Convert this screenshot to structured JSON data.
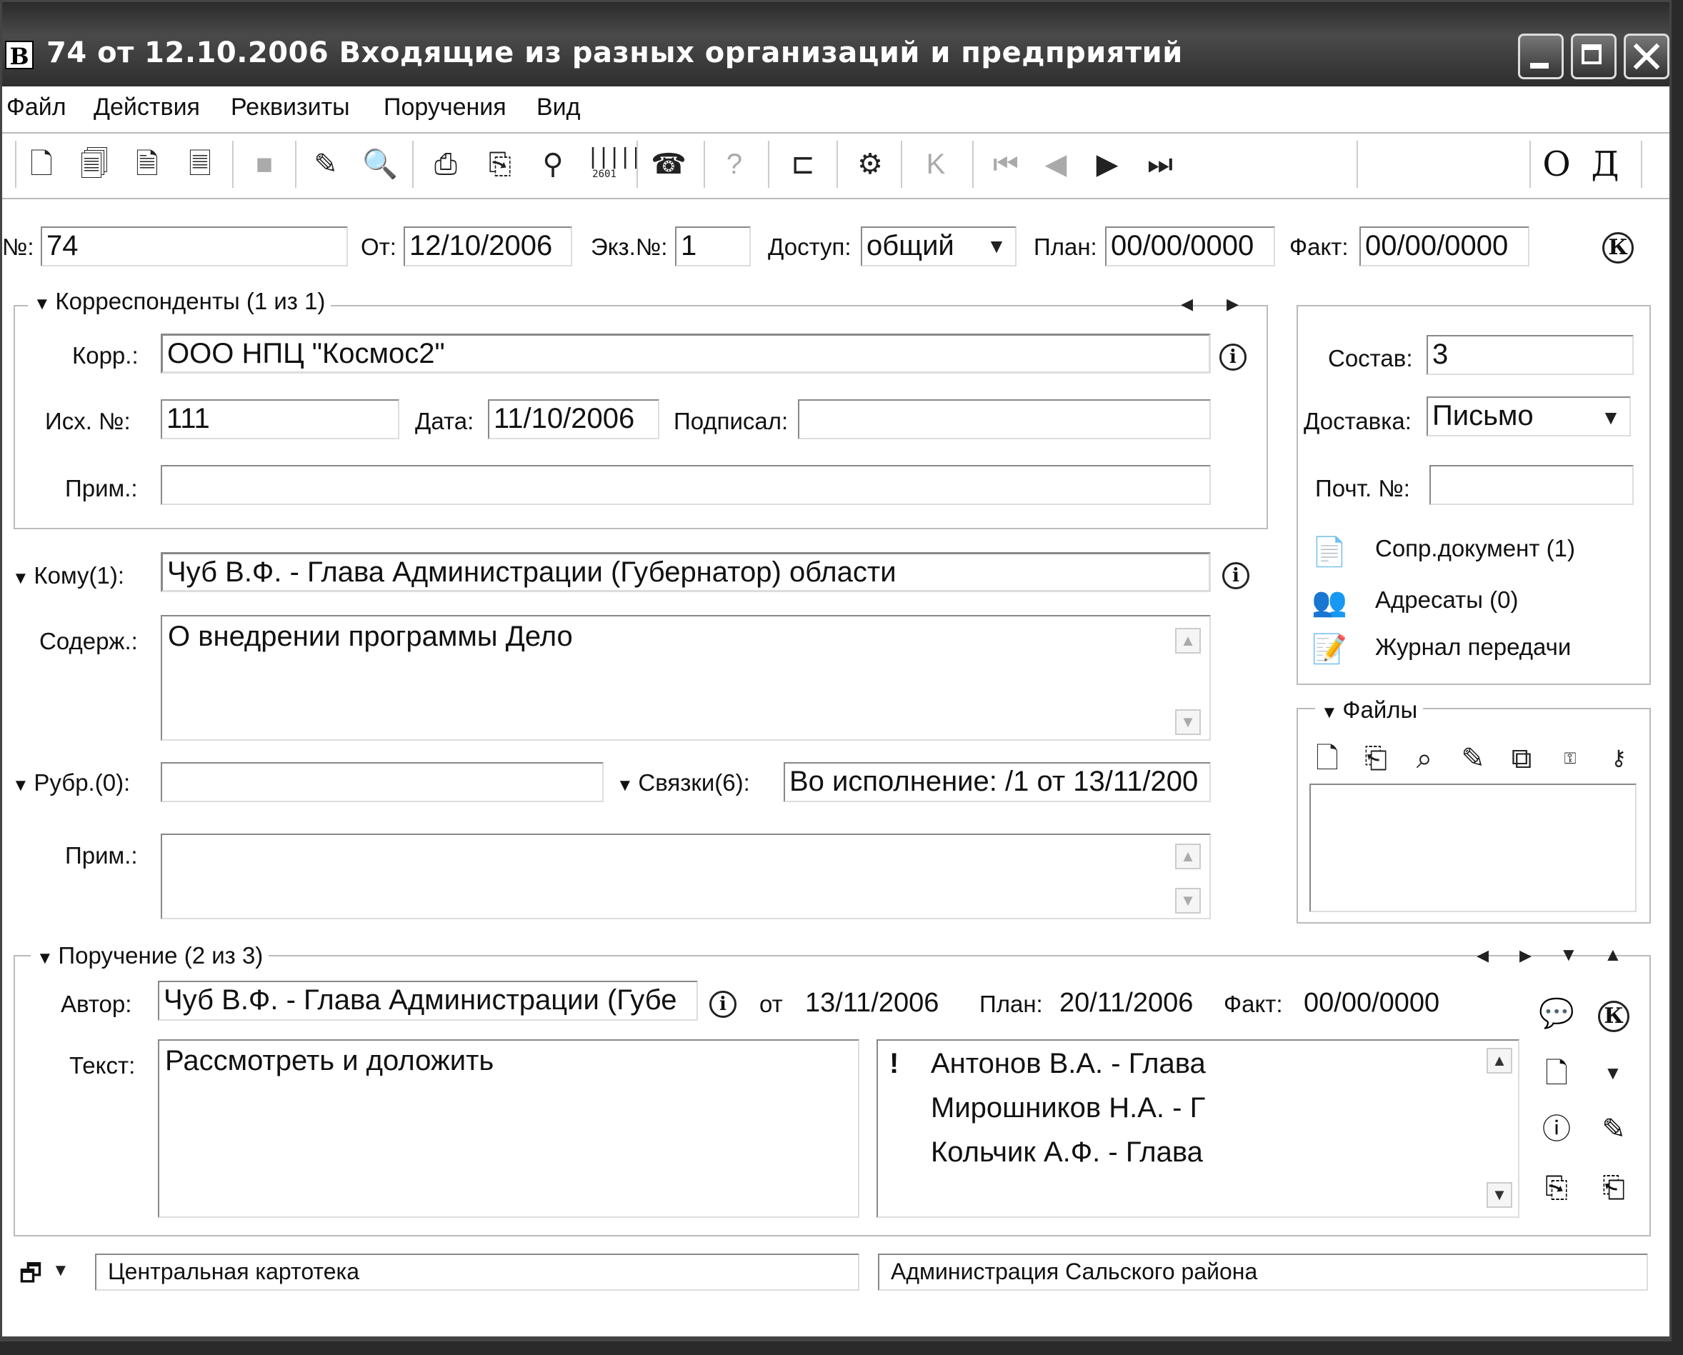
{
  "window": {
    "app_icon_letter": "В",
    "title": "74 от 12.10.2006 Входящие из разных организаций и предприятий"
  },
  "menu": [
    "Файл",
    "Действия",
    "Реквизиты",
    "Поручения",
    "Вид"
  ],
  "toolbar": {
    "icons": [
      "new-doc-icon",
      "new-doc-copy-icon",
      "new-doc-register-icon",
      "new-doc-link-icon",
      "stop-icon",
      "edit-card-icon",
      "view-card-icon",
      "print-icon",
      "print-preview-icon",
      "stamp-icon",
      "barcode-icon",
      "addressee-icon",
      "help-doc-icon",
      "rubric-icon",
      "settings-icon",
      "control-icon",
      "first-record-icon",
      "prev-record-icon",
      "next-record-icon",
      "last-record-icon"
    ],
    "barcode_label": "2601",
    "right_buttons": [
      "О",
      "Д"
    ]
  },
  "header_fields": {
    "number_label": "№:",
    "number_value": "74",
    "from_label": "От:",
    "from_value": "12/10/2006",
    "copy_label": "Экз.№:",
    "copy_value": "1",
    "access_label": "Доступ:",
    "access_value": "общий",
    "plan_label": "План:",
    "plan_value": "00/00/0000",
    "fact_label": "Факт:",
    "fact_value": "00/00/0000",
    "control_mark": "К"
  },
  "correspondents": {
    "title": "Корреспонденты (1 из 1)",
    "corr_label": "Корр.:",
    "corr_value": "ООО НПЦ \"Космос2\"",
    "outnum_label": "Исх. №:",
    "outnum_value": "111",
    "date_label": "Дата:",
    "date_value": "11/10/2006",
    "signed_label": "Подписал:",
    "signed_value": "",
    "note_label": "Прим.:",
    "note_value": ""
  },
  "right_panel": {
    "composition_label": "Состав:",
    "composition_value": "3",
    "delivery_label": "Доставка:",
    "delivery_value": "Письмо",
    "postal_label": "Почт. №:",
    "postal_value": "",
    "links": [
      {
        "icon": "attached-document-icon",
        "label": "Сопр.документ (1)"
      },
      {
        "icon": "addressees-icon",
        "label": "Адресаты (0)"
      },
      {
        "icon": "transfer-journal-icon",
        "label": "Журнал передачи"
      }
    ],
    "files_title": "Файлы",
    "file_tool_icons": [
      "add-file-icon",
      "scan-file-icon",
      "view-file-icon",
      "edit-file-icon",
      "copy-file-icon",
      "encrypt-file-icon",
      "sign-file-icon"
    ]
  },
  "body": {
    "to_label": "Кому(1):",
    "to_value": "Чуб В.Ф. - Глава Администрации (Губернатор) области",
    "content_label": "Содерж.:",
    "content_value": "О внедрении программы Дело",
    "rubric_label": "Рубр.(0):",
    "rubric_value": "",
    "links_label": "Связки(6):",
    "links_value": "Во исполнение: /1 от 13/11/200",
    "note_label": "Прим.:",
    "note_value": ""
  },
  "assignment": {
    "title": "Поручение (2 из 3)",
    "author_label": "Автор:",
    "author_value": "Чуб В.Ф. - Глава Администрации (Губе",
    "from_label": "от",
    "from_value": "13/11/2006",
    "plan_label": "План:",
    "plan_value": "20/11/2006",
    "fact_label": "Факт:",
    "fact_value": "00/00/0000",
    "text_label": "Текст:",
    "text_value": "Рассмотреть и доложить",
    "executors": [
      {
        "mark": "!",
        "name": "Антонов В.А. - Глава"
      },
      {
        "mark": "",
        "name": "Мирошников Н.А. - Г"
      },
      {
        "mark": "",
        "name": "Кольчик А.Ф. - Глава"
      }
    ],
    "control_mark": "К"
  },
  "status": {
    "cabinet": "Центральная картотека",
    "organization": "Администрация Сальского района"
  }
}
